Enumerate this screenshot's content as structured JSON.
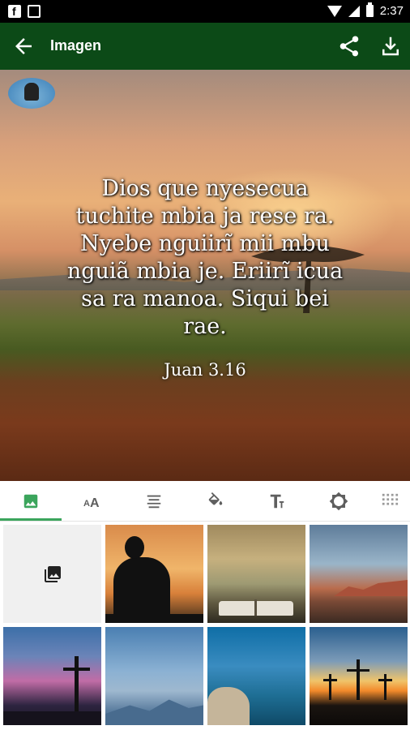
{
  "status_bar": {
    "time": "2:37"
  },
  "app_bar": {
    "title": "Imagen"
  },
  "preview": {
    "verse_lines": [
      "Dios que nyesecua",
      "tuchite mbia ja rese ra.",
      "Nyebe nguiirĩ mii mbu",
      "nguiã mbia je. Eriirĩ icua",
      "sa ra manoa. Siqui bei",
      "rae."
    ],
    "reference": "Juan 3.16"
  },
  "tabs": [
    {
      "name": "background-image-tab",
      "icon": "image-icon",
      "active": true
    },
    {
      "name": "font-size-tab",
      "icon": "font-size-icon",
      "active": false
    },
    {
      "name": "text-align-tab",
      "icon": "align-icon",
      "active": false
    },
    {
      "name": "fill-color-tab",
      "icon": "paint-bucket-icon",
      "active": false
    },
    {
      "name": "text-style-tab",
      "icon": "text-format-icon",
      "active": false
    },
    {
      "name": "brightness-tab",
      "icon": "brightness-icon",
      "active": false
    },
    {
      "name": "more-tab",
      "icon": "grid-dots-icon",
      "active": false
    }
  ],
  "accent_color": "#3ba55c",
  "app_bar_color": "#0c4a17"
}
